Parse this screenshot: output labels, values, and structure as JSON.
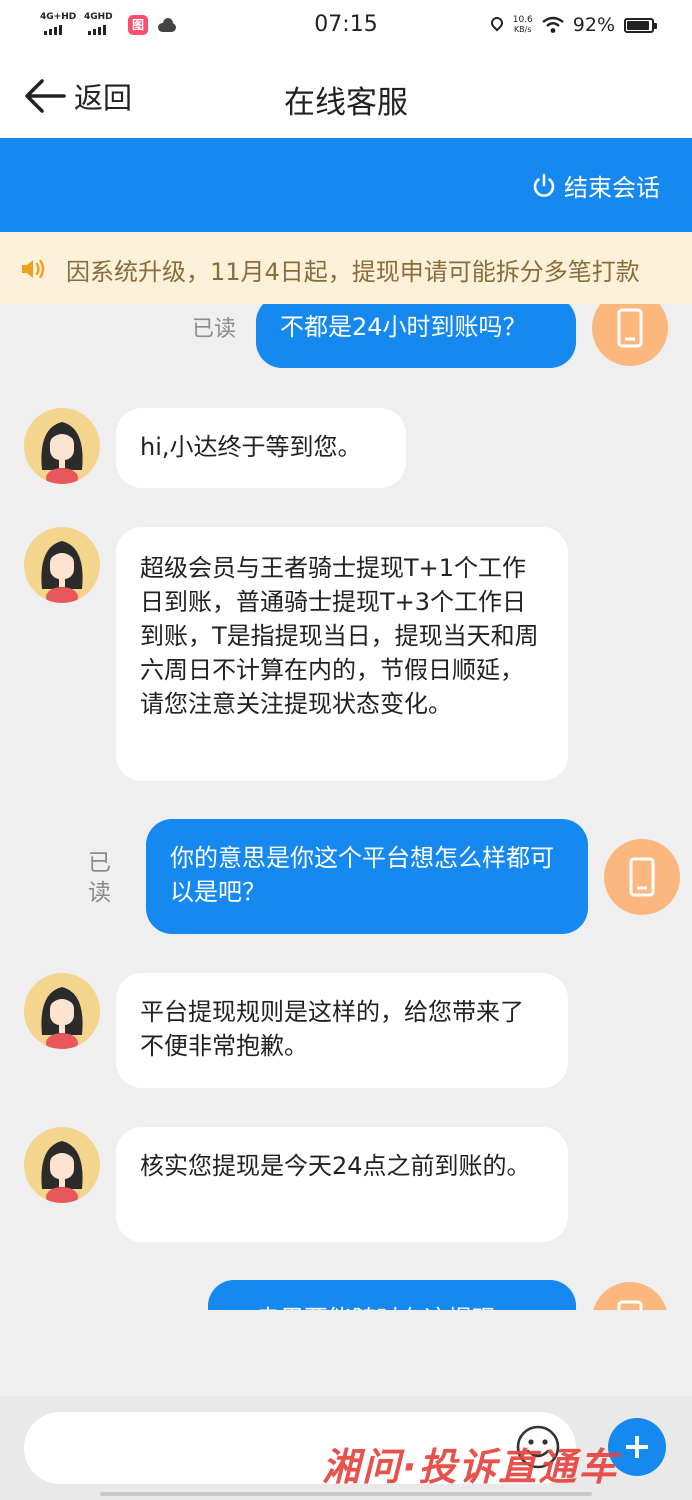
{
  "status_bar": {
    "net1_label": "4G+HD",
    "net2_label": "4GHD",
    "app_badge": "图",
    "time": "07:15",
    "speed_value": "10.6",
    "speed_unit": "KB/s",
    "battery_percent": "92%",
    "battery_level": 0.92
  },
  "nav": {
    "back_label": "返回",
    "title": "在线客服"
  },
  "action_bar": {
    "end_session_label": "结束会话"
  },
  "notice": {
    "text": "因系统升级，11月4日起，提现申请可能拆分多笔打款"
  },
  "messages": [
    {
      "from": "user",
      "text": "不都是24小时到账吗？",
      "read": "已读"
    },
    {
      "from": "agent",
      "text": "hi,小达终于等到您。"
    },
    {
      "from": "agent",
      "text": "超级会员与王者骑士提现T+1个工作日到账，普通骑士提现T+3个工作日到账，T是指提现当日，提现当天和周六周日不计算在内的，节假日顺延，请您注意关注提现状态变化。"
    },
    {
      "from": "user",
      "text": "你的意思是你这个平台想怎么样都可以是吧？",
      "read_line1": "已",
      "read_line2": "读"
    },
    {
      "from": "agent",
      "text": "平台提现规则是这样的，给您带来了不便非常抱歉。"
    },
    {
      "from": "agent",
      "text": "核实您提现是今天24点之前到账的。"
    },
    {
      "from": "user",
      "text": "一串里要能随时在这提现"
    }
  ],
  "input": {
    "placeholder": ""
  },
  "watermark": "湘问·投诉直通车",
  "icons": {
    "back": "arrow-left-icon",
    "power": "power-icon",
    "speaker": "speaker-icon",
    "phone": "phone-icon",
    "emoji": "smiley-icon",
    "plus": "plus-icon"
  },
  "colors": {
    "primary_blue": "#1589f0",
    "notice_bg": "#fdf1d9",
    "notice_text": "#8a6d3b",
    "user_avatar": "#fbb77e",
    "agent_avatar": "#f4d58d",
    "chat_bg": "#efefef"
  }
}
